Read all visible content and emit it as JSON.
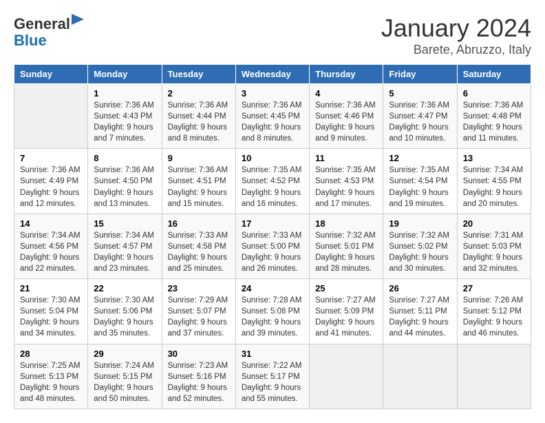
{
  "header": {
    "logo_general": "General",
    "logo_blue": "Blue",
    "month": "January 2024",
    "location": "Barete, Abruzzo, Italy"
  },
  "days_of_week": [
    "Sunday",
    "Monday",
    "Tuesday",
    "Wednesday",
    "Thursday",
    "Friday",
    "Saturday"
  ],
  "weeks": [
    [
      {
        "day": "",
        "info": ""
      },
      {
        "day": "1",
        "info": "Sunrise: 7:36 AM\nSunset: 4:43 PM\nDaylight: 9 hours\nand 7 minutes."
      },
      {
        "day": "2",
        "info": "Sunrise: 7:36 AM\nSunset: 4:44 PM\nDaylight: 9 hours\nand 8 minutes."
      },
      {
        "day": "3",
        "info": "Sunrise: 7:36 AM\nSunset: 4:45 PM\nDaylight: 9 hours\nand 8 minutes."
      },
      {
        "day": "4",
        "info": "Sunrise: 7:36 AM\nSunset: 4:46 PM\nDaylight: 9 hours\nand 9 minutes."
      },
      {
        "day": "5",
        "info": "Sunrise: 7:36 AM\nSunset: 4:47 PM\nDaylight: 9 hours\nand 10 minutes."
      },
      {
        "day": "6",
        "info": "Sunrise: 7:36 AM\nSunset: 4:48 PM\nDaylight: 9 hours\nand 11 minutes."
      }
    ],
    [
      {
        "day": "7",
        "info": "Sunrise: 7:36 AM\nSunset: 4:49 PM\nDaylight: 9 hours\nand 12 minutes."
      },
      {
        "day": "8",
        "info": "Sunrise: 7:36 AM\nSunset: 4:50 PM\nDaylight: 9 hours\nand 13 minutes."
      },
      {
        "day": "9",
        "info": "Sunrise: 7:36 AM\nSunset: 4:51 PM\nDaylight: 9 hours\nand 15 minutes."
      },
      {
        "day": "10",
        "info": "Sunrise: 7:35 AM\nSunset: 4:52 PM\nDaylight: 9 hours\nand 16 minutes."
      },
      {
        "day": "11",
        "info": "Sunrise: 7:35 AM\nSunset: 4:53 PM\nDaylight: 9 hours\nand 17 minutes."
      },
      {
        "day": "12",
        "info": "Sunrise: 7:35 AM\nSunset: 4:54 PM\nDaylight: 9 hours\nand 19 minutes."
      },
      {
        "day": "13",
        "info": "Sunrise: 7:34 AM\nSunset: 4:55 PM\nDaylight: 9 hours\nand 20 minutes."
      }
    ],
    [
      {
        "day": "14",
        "info": "Sunrise: 7:34 AM\nSunset: 4:56 PM\nDaylight: 9 hours\nand 22 minutes."
      },
      {
        "day": "15",
        "info": "Sunrise: 7:34 AM\nSunset: 4:57 PM\nDaylight: 9 hours\nand 23 minutes."
      },
      {
        "day": "16",
        "info": "Sunrise: 7:33 AM\nSunset: 4:58 PM\nDaylight: 9 hours\nand 25 minutes."
      },
      {
        "day": "17",
        "info": "Sunrise: 7:33 AM\nSunset: 5:00 PM\nDaylight: 9 hours\nand 26 minutes."
      },
      {
        "day": "18",
        "info": "Sunrise: 7:32 AM\nSunset: 5:01 PM\nDaylight: 9 hours\nand 28 minutes."
      },
      {
        "day": "19",
        "info": "Sunrise: 7:32 AM\nSunset: 5:02 PM\nDaylight: 9 hours\nand 30 minutes."
      },
      {
        "day": "20",
        "info": "Sunrise: 7:31 AM\nSunset: 5:03 PM\nDaylight: 9 hours\nand 32 minutes."
      }
    ],
    [
      {
        "day": "21",
        "info": "Sunrise: 7:30 AM\nSunset: 5:04 PM\nDaylight: 9 hours\nand 34 minutes."
      },
      {
        "day": "22",
        "info": "Sunrise: 7:30 AM\nSunset: 5:06 PM\nDaylight: 9 hours\nand 35 minutes."
      },
      {
        "day": "23",
        "info": "Sunrise: 7:29 AM\nSunset: 5:07 PM\nDaylight: 9 hours\nand 37 minutes."
      },
      {
        "day": "24",
        "info": "Sunrise: 7:28 AM\nSunset: 5:08 PM\nDaylight: 9 hours\nand 39 minutes."
      },
      {
        "day": "25",
        "info": "Sunrise: 7:27 AM\nSunset: 5:09 PM\nDaylight: 9 hours\nand 41 minutes."
      },
      {
        "day": "26",
        "info": "Sunrise: 7:27 AM\nSunset: 5:11 PM\nDaylight: 9 hours\nand 44 minutes."
      },
      {
        "day": "27",
        "info": "Sunrise: 7:26 AM\nSunset: 5:12 PM\nDaylight: 9 hours\nand 46 minutes."
      }
    ],
    [
      {
        "day": "28",
        "info": "Sunrise: 7:25 AM\nSunset: 5:13 PM\nDaylight: 9 hours\nand 48 minutes."
      },
      {
        "day": "29",
        "info": "Sunrise: 7:24 AM\nSunset: 5:15 PM\nDaylight: 9 hours\nand 50 minutes."
      },
      {
        "day": "30",
        "info": "Sunrise: 7:23 AM\nSunset: 5:16 PM\nDaylight: 9 hours\nand 52 minutes."
      },
      {
        "day": "31",
        "info": "Sunrise: 7:22 AM\nSunset: 5:17 PM\nDaylight: 9 hours\nand 55 minutes."
      },
      {
        "day": "",
        "info": ""
      },
      {
        "day": "",
        "info": ""
      },
      {
        "day": "",
        "info": ""
      }
    ]
  ]
}
